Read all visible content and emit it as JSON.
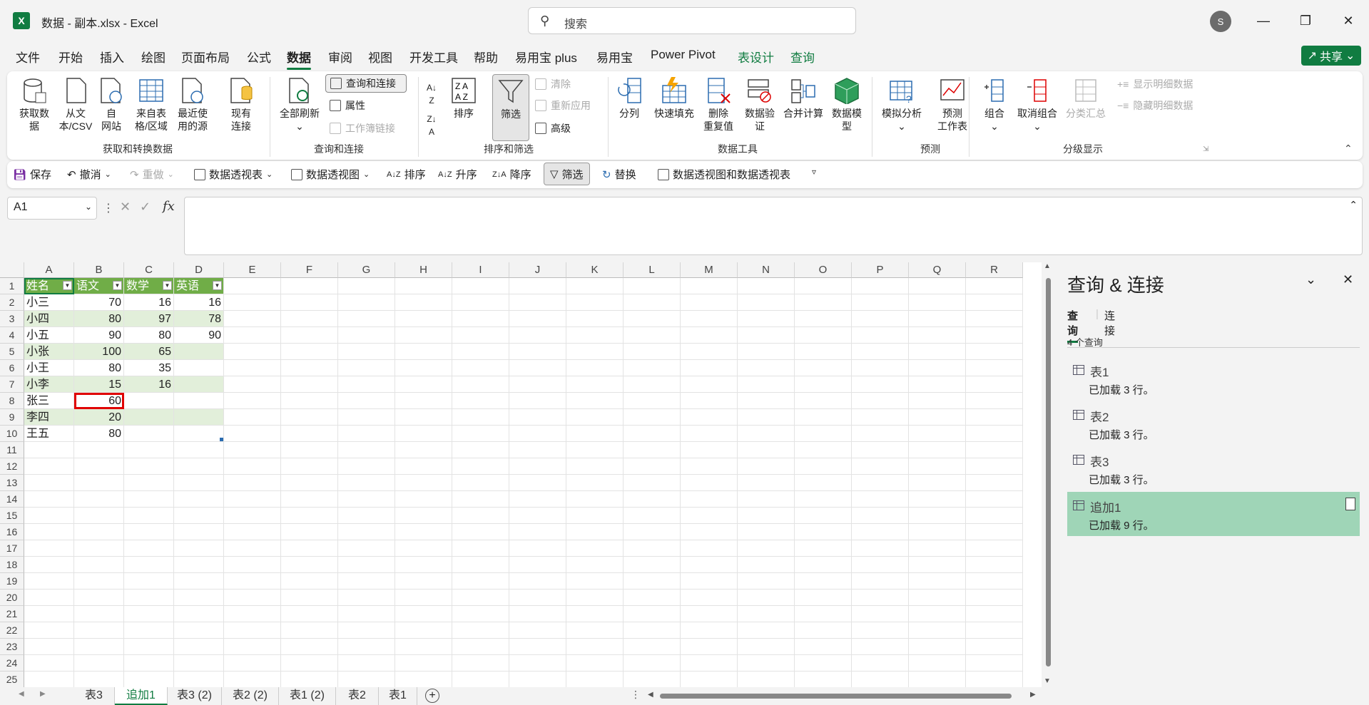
{
  "window": {
    "title": "数据 - 副本.xlsx  -  Excel",
    "logo": "X",
    "search_placeholder": "搜索",
    "user_initial": "S"
  },
  "menu": [
    "文件",
    "开始",
    "插入",
    "绘图",
    "页面布局",
    "公式",
    "数据",
    "审阅",
    "视图",
    "开发工具",
    "帮助",
    "易用宝 plus",
    "易用宝",
    "Power Pivot",
    "表设计",
    "查询"
  ],
  "share_label": "共享",
  "ribbon": {
    "get_data": "获取数\n据",
    "from_csv": "从文\n本/CSV",
    "from_web": "自\n网站",
    "from_table": "来自表\n格/区域",
    "recent": "最近使\n用的源",
    "existing": "现有\n连接",
    "group1": "获取和转换数据",
    "refresh_all": "全部刷新",
    "queries_conn": "查询和连接",
    "properties": "属性",
    "workbook_links": "工作簿链接",
    "group2": "查询和连接",
    "sort": "排序",
    "filter": "筛选",
    "clear": "清除",
    "reapply": "重新应用",
    "advanced": "高级",
    "group3": "排序和筛选",
    "split": "分列",
    "flash_fill": "快速填充",
    "remove_dup": "删除\n重复值",
    "validation": "数据验\n证",
    "consolidate": "合并计算",
    "data_model": "数据模\n型",
    "group4": "数据工具",
    "whatif": "模拟分析",
    "forecast": "预测\n工作表",
    "group5": "预测",
    "group_btn": "组合",
    "ungroup": "取消组合",
    "subtotal": "分类汇总",
    "show_detail": "显示明细数据",
    "hide_detail": "隐藏明细数据",
    "group6": "分级显示"
  },
  "qat": [
    "保存",
    "撤消",
    "重做",
    "数据透视表",
    "数据透视图",
    "排序",
    "升序",
    "降序",
    "筛选",
    "替换",
    "数据透视图和数据透视表"
  ],
  "namebox": "A1",
  "columns": [
    "A",
    "B",
    "C",
    "D",
    "E",
    "F",
    "G",
    "H",
    "I",
    "J",
    "K",
    "L",
    "M",
    "N",
    "O",
    "P",
    "Q",
    "R"
  ],
  "rows": [
    "1",
    "2",
    "3",
    "4",
    "5",
    "6",
    "7",
    "8",
    "9",
    "10",
    "11",
    "12",
    "13",
    "14",
    "15",
    "16",
    "17",
    "18",
    "19",
    "20",
    "21",
    "22",
    "23",
    "24",
    "25"
  ],
  "table": {
    "headers": [
      "姓名",
      "语文",
      "数学",
      "英语"
    ],
    "data": [
      [
        "小三",
        "70",
        "16",
        "16"
      ],
      [
        "小四",
        "80",
        "97",
        "78"
      ],
      [
        "小五",
        "90",
        "80",
        "90"
      ],
      [
        "小张",
        "100",
        "65",
        ""
      ],
      [
        "小王",
        "80",
        "35",
        ""
      ],
      [
        "小李",
        "15",
        "16",
        ""
      ],
      [
        "张三",
        "60",
        "",
        ""
      ],
      [
        "李四",
        "20",
        "",
        ""
      ],
      [
        "王五",
        "80",
        "",
        ""
      ]
    ]
  },
  "sheets": [
    "表3",
    "追加1",
    "表3 (2)",
    "表2 (2)",
    "表1 (2)",
    "表2",
    "表1"
  ],
  "active_sheet": "追加1",
  "pane": {
    "title": "查询 & 连接",
    "tab_query": "查询",
    "tab_conn": "连接",
    "count": "4 个查询",
    "items": [
      {
        "name": "表1",
        "status": "已加载 3 行。"
      },
      {
        "name": "表2",
        "status": "已加载 3 行。"
      },
      {
        "name": "表3",
        "status": "已加载 3 行。"
      },
      {
        "name": "追加1",
        "status": "已加载 9 行。"
      }
    ]
  },
  "colors": {
    "accent": "#107c41",
    "table_header": "#70ad47",
    "band": "#e2efda",
    "highlight": "#e00000",
    "selected_query": "#9fd5b7"
  }
}
